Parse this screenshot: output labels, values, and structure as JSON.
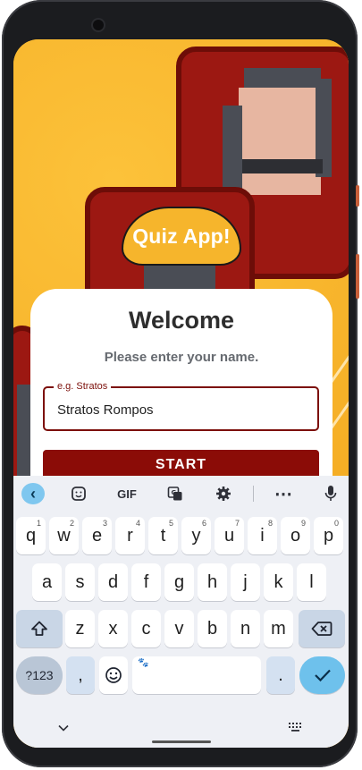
{
  "app": {
    "bubble_title": "Quiz App!",
    "welcome_title": "Welcome",
    "prompt": "Please enter your name.",
    "name_field": {
      "label": "e.g. Stratos",
      "value": "Stratos Rompos"
    },
    "start_label": "START"
  },
  "colors": {
    "accent": "#8b0c07",
    "background": "#f6b52c",
    "keyboard_bg": "#eef0f5",
    "enter_key": "#6ec1ec"
  },
  "keyboard": {
    "toolbar": {
      "back_icon": "chevron-left-icon",
      "sticker_icon": "sticker-icon",
      "gif_label": "GIF",
      "translate_icon": "translate-icon",
      "settings_icon": "gear-icon",
      "more_icon": "more-horizontal-icon",
      "mic_icon": "microphone-icon"
    },
    "row1": [
      {
        "key": "q",
        "hint": "1"
      },
      {
        "key": "w",
        "hint": "2"
      },
      {
        "key": "e",
        "hint": "3"
      },
      {
        "key": "r",
        "hint": "4"
      },
      {
        "key": "t",
        "hint": "5"
      },
      {
        "key": "y",
        "hint": "6"
      },
      {
        "key": "u",
        "hint": "7"
      },
      {
        "key": "i",
        "hint": "8"
      },
      {
        "key": "o",
        "hint": "9"
      },
      {
        "key": "p",
        "hint": "0"
      }
    ],
    "row2": [
      "a",
      "s",
      "d",
      "f",
      "g",
      "h",
      "j",
      "k",
      "l"
    ],
    "row3": [
      "z",
      "x",
      "c",
      "v",
      "b",
      "n",
      "m"
    ],
    "symbols_label": "?123",
    "comma_label": ",",
    "period_label": ".",
    "shift_icon": "shift-arrow-icon",
    "backspace_icon": "backspace-icon",
    "emoji_icon": "emoji-icon",
    "enter_icon": "checkmark-icon",
    "hide_icon": "chevron-down-icon",
    "switch_icon": "keyboard-icon"
  }
}
